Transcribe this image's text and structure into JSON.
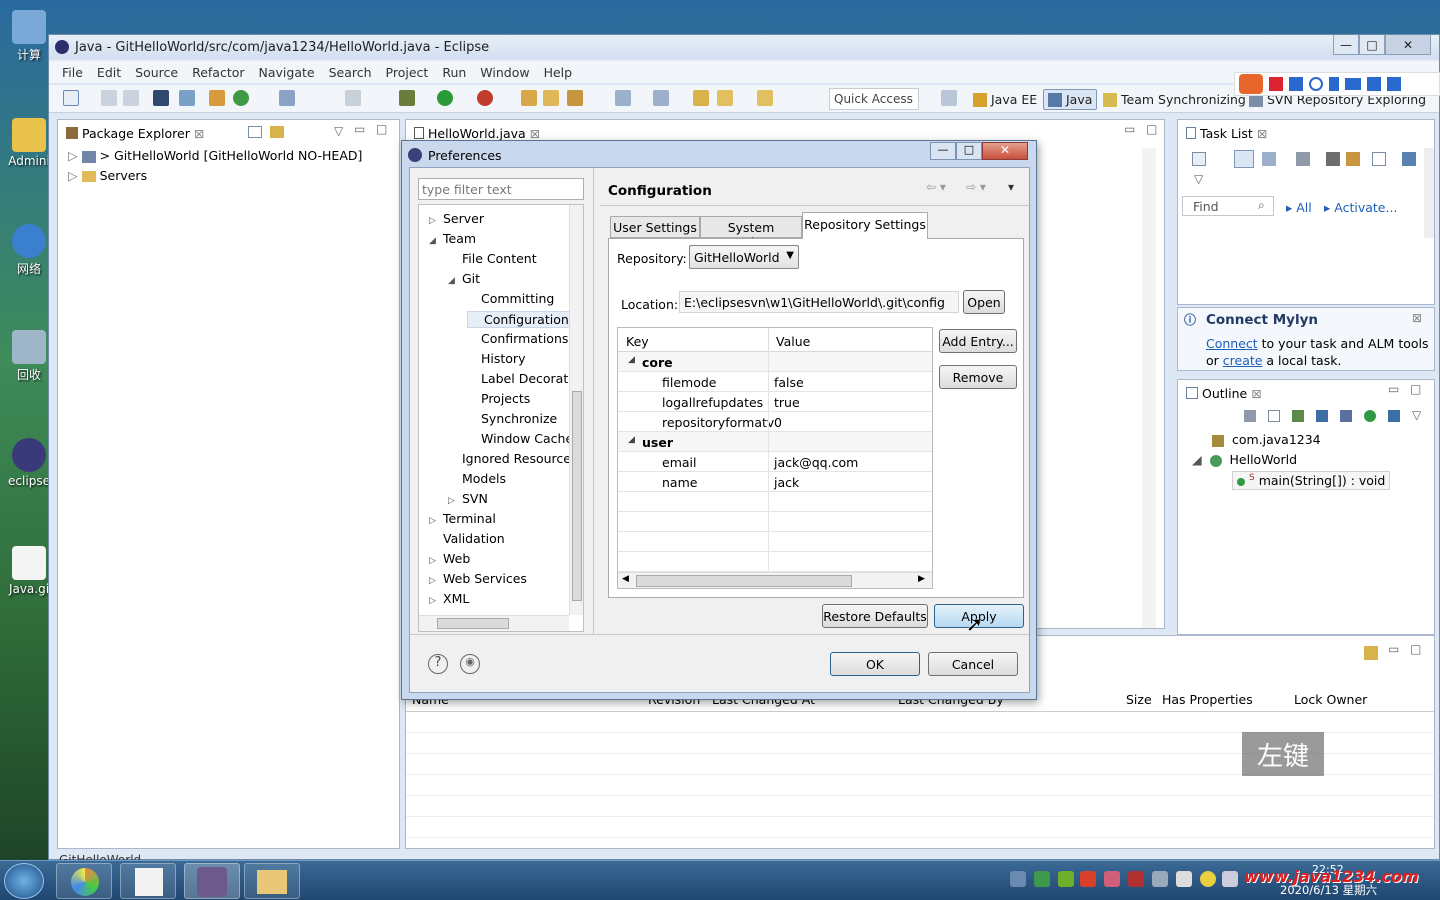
{
  "desktop": {
    "icons": [
      "计算",
      "Admini",
      "网络",
      "回收",
      "eclipse",
      "Java.gi"
    ]
  },
  "window": {
    "title": "Java - GitHelloWorld/src/com/java1234/HelloWorld.java - Eclipse",
    "min": "—",
    "max": "□",
    "close": "✕"
  },
  "menu": [
    "File",
    "Edit",
    "Source",
    "Refactor",
    "Navigate",
    "Search",
    "Project",
    "Run",
    "Window",
    "Help"
  ],
  "toolbar": {
    "quick_access": "Quick Access",
    "perspectives": [
      "Java EE",
      "Java",
      "Team Synchronizing",
      "SVN Repository Exploring"
    ]
  },
  "package_explorer": {
    "tab": "Package Explorer",
    "items": [
      "> GitHelloWorld  [GitHelloWorld NO-HEAD]",
      "Servers"
    ],
    "status": "GitHelloWorld"
  },
  "editor": {
    "tab": "HelloWorld.java"
  },
  "tasklist": {
    "tab": "Task List",
    "find_placeholder": "Find",
    "all": "All",
    "activate": "Activate..."
  },
  "mylyn": {
    "title": "Connect Mylyn",
    "link1": "Connect",
    "text1": " to your task and ALM tools",
    "text2a": "or ",
    "link2": "create",
    "text2b": " a local task."
  },
  "outline": {
    "tab": "Outline",
    "package": "com.java1234",
    "class": "HelloWorld",
    "method": "main(String[]) : void"
  },
  "bottom": {
    "columns": [
      "Name",
      "Revision",
      "Last Changed At",
      "Last Changed By",
      "Size",
      "Has Properties",
      "Lock Owner"
    ]
  },
  "overlay": {
    "key_label": "左键",
    "watermark": "www.java1234.com"
  },
  "dialog": {
    "title": "Preferences",
    "filter_placeholder": "type filter text",
    "tree": [
      {
        "label": "Server",
        "level": 0,
        "arrow": "▷"
      },
      {
        "label": "Team",
        "level": 0,
        "arrow": "◢"
      },
      {
        "label": "File Content",
        "level": 1,
        "arrow": ""
      },
      {
        "label": "Git",
        "level": 1,
        "arrow": "◢"
      },
      {
        "label": "Committing",
        "level": 2,
        "arrow": ""
      },
      {
        "label": "Configuration",
        "level": 2,
        "arrow": "",
        "selected": true
      },
      {
        "label": "Confirmations a",
        "level": 2,
        "arrow": ""
      },
      {
        "label": "History",
        "level": 2,
        "arrow": ""
      },
      {
        "label": "Label Decoratio",
        "level": 2,
        "arrow": ""
      },
      {
        "label": "Projects",
        "level": 2,
        "arrow": ""
      },
      {
        "label": "Synchronize",
        "level": 2,
        "arrow": ""
      },
      {
        "label": "Window Cache",
        "level": 2,
        "arrow": ""
      },
      {
        "label": "Ignored Resource",
        "level": 1,
        "arrow": ""
      },
      {
        "label": "Models",
        "level": 1,
        "arrow": ""
      },
      {
        "label": "SVN",
        "level": 1,
        "arrow": "▷"
      },
      {
        "label": "Terminal",
        "level": 0,
        "arrow": "▷"
      },
      {
        "label": "Validation",
        "level": 0,
        "arrow": ""
      },
      {
        "label": "Web",
        "level": 0,
        "arrow": "▷"
      },
      {
        "label": "Web Services",
        "level": 0,
        "arrow": "▷"
      },
      {
        "label": "XML",
        "level": 0,
        "arrow": "▷"
      }
    ],
    "page_title": "Configuration",
    "tabs": [
      "User Settings",
      "System Settings",
      "Repository Settings"
    ],
    "repository_label": "Repository:",
    "repository_value": "GitHelloWorld",
    "location_label": "Location:",
    "location_value": "E:\\eclipsesvn\\w1\\GitHelloWorld\\.git\\config",
    "open": "Open",
    "col_key": "Key",
    "col_value": "Value",
    "rows": [
      {
        "key": "core",
        "value": "",
        "section": true
      },
      {
        "key": "filemode",
        "value": "false"
      },
      {
        "key": "logallrefupdates",
        "value": "true"
      },
      {
        "key": "repositoryformatv",
        "value": "0"
      },
      {
        "key": "user",
        "value": "",
        "section": true
      },
      {
        "key": "email",
        "value": "jack@qq.com"
      },
      {
        "key": "name",
        "value": "jack"
      }
    ],
    "add_entry": "Add Entry...",
    "remove": "Remove",
    "restore_defaults": "Restore Defaults",
    "apply": "Apply",
    "ok": "OK",
    "cancel": "Cancel"
  },
  "taskbar": {
    "clock_time": "22:52",
    "date": "2020/6/13 星期六"
  }
}
